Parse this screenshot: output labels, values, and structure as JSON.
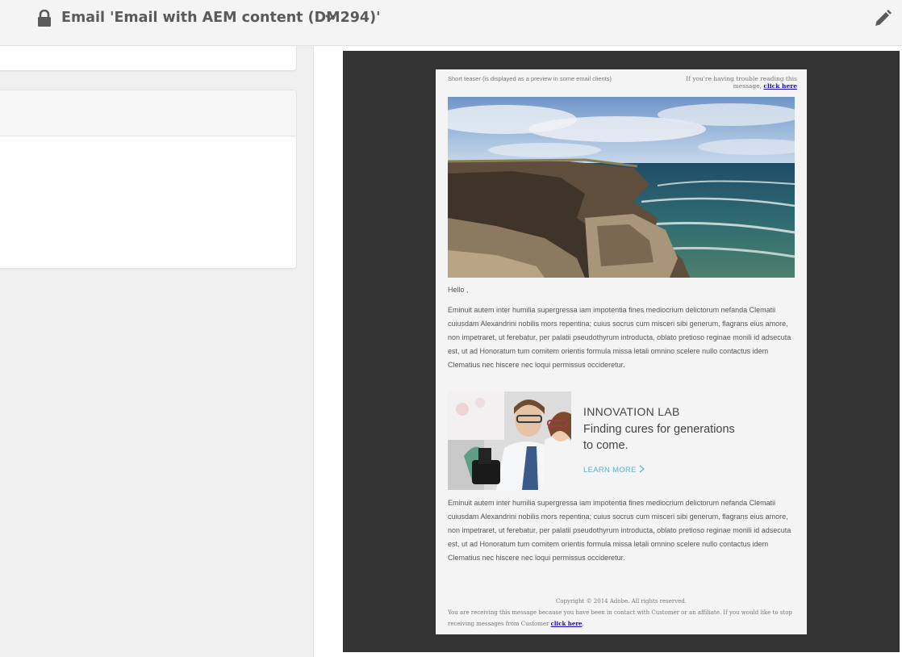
{
  "header": {
    "title": "Email 'Email with AEM content (DM294)'",
    "lock_icon": "lock-icon",
    "dropdown_icon": "chevron-down-icon",
    "edit_icon": "pencil-icon"
  },
  "email": {
    "teaser": "Short teaser (is displayed as a preview in some email clients)",
    "trouble_text": "If you're having trouble reading this message,",
    "trouble_link": "click here",
    "greeting": "Hello ,",
    "body_text": "Eminuit autem inter humilia supergressa iam impotentia fines mediocrium delictorum nefanda Clematii cuiusdam Alexandrini nobilis mors repentina; cuius socrus cum misceri sibi generum, flagrans eius amore, non impetraret, ut ferebatur, per palatii pseudothyrum introducta, oblato pretioso reginae monili id adsecuta est, ut ad Honoratum tum comitem orientis formula missa letali omnino scelere nullo contactus idem Clematius nec hiscere nec loqui permissus occideretur.",
    "banner": {
      "title": "INNOVATION LAB",
      "subtitle": "Finding cures for generations to come.",
      "link": "LEARN MORE"
    },
    "body_text_2": "Eminuit autem inter humilia supergressa iam impotentia fines mediocrium delictorum nefanda Clematii cuiusdam Alexandrini nobilis mors repentina; cuius socrus cum misceri sibi generum, flagrans eius amore, non impetraret, ut ferebatur, per palatii pseudothyrum introducta, oblato pretioso reginae monili id adsecuta est, ut ad Honoratum tum comitem orientis formula missa letali omnino scelere nullo contactus idem Clematius nec hiscere nec loqui permissus occideretur.",
    "copyright": "Copyright © 2014 Adobe. All rights reserved.",
    "footer_text": "You are receiving this message because you have been in contact with Customer or an affiliate. If you would like to stop receiving messages from Customer",
    "footer_link": "click here",
    "footer_end": "."
  },
  "colors": {
    "preview_background": "#333333",
    "link": "#1a0dab",
    "learn_more": "#5ab0d6"
  }
}
